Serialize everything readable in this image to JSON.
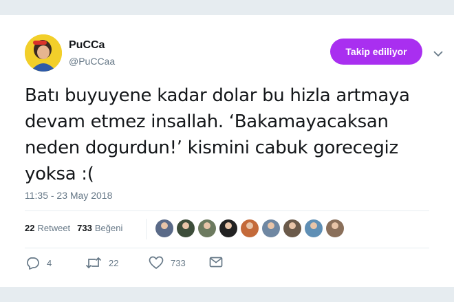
{
  "user": {
    "name": "PuCCa",
    "handle": "@PuCCaa"
  },
  "follow_button": {
    "label": "Takip ediliyor"
  },
  "tweet": {
    "lines": [
      "Batı buyuyene kadar dolar bu hizla artmaya",
      "devam etmez insallah. ‘Bakamayacaksan",
      "neden dogurdun!’ kismini cabuk gorecegiz",
      "yoksa :("
    ],
    "timestamp": "11:35 - 23 May 2018"
  },
  "stats": {
    "retweets": "22",
    "retweet_label": "Retweet",
    "likes": "733",
    "likes_label": "Beğeni"
  },
  "likers": [
    "#5a6a88",
    "#3d4d3a",
    "#6c7a5f",
    "#222222",
    "#c46a3a",
    "#6f87a2",
    "#6b5a4a",
    "#5f8fb5",
    "#8a6f5a"
  ],
  "actions": {
    "reply_count": "4",
    "retweet_count": "22",
    "like_count": "733"
  },
  "colors": {
    "accent": "#a92ff0",
    "text": "#14171a",
    "secondary": "#657786",
    "background": "#e6ecf0"
  }
}
